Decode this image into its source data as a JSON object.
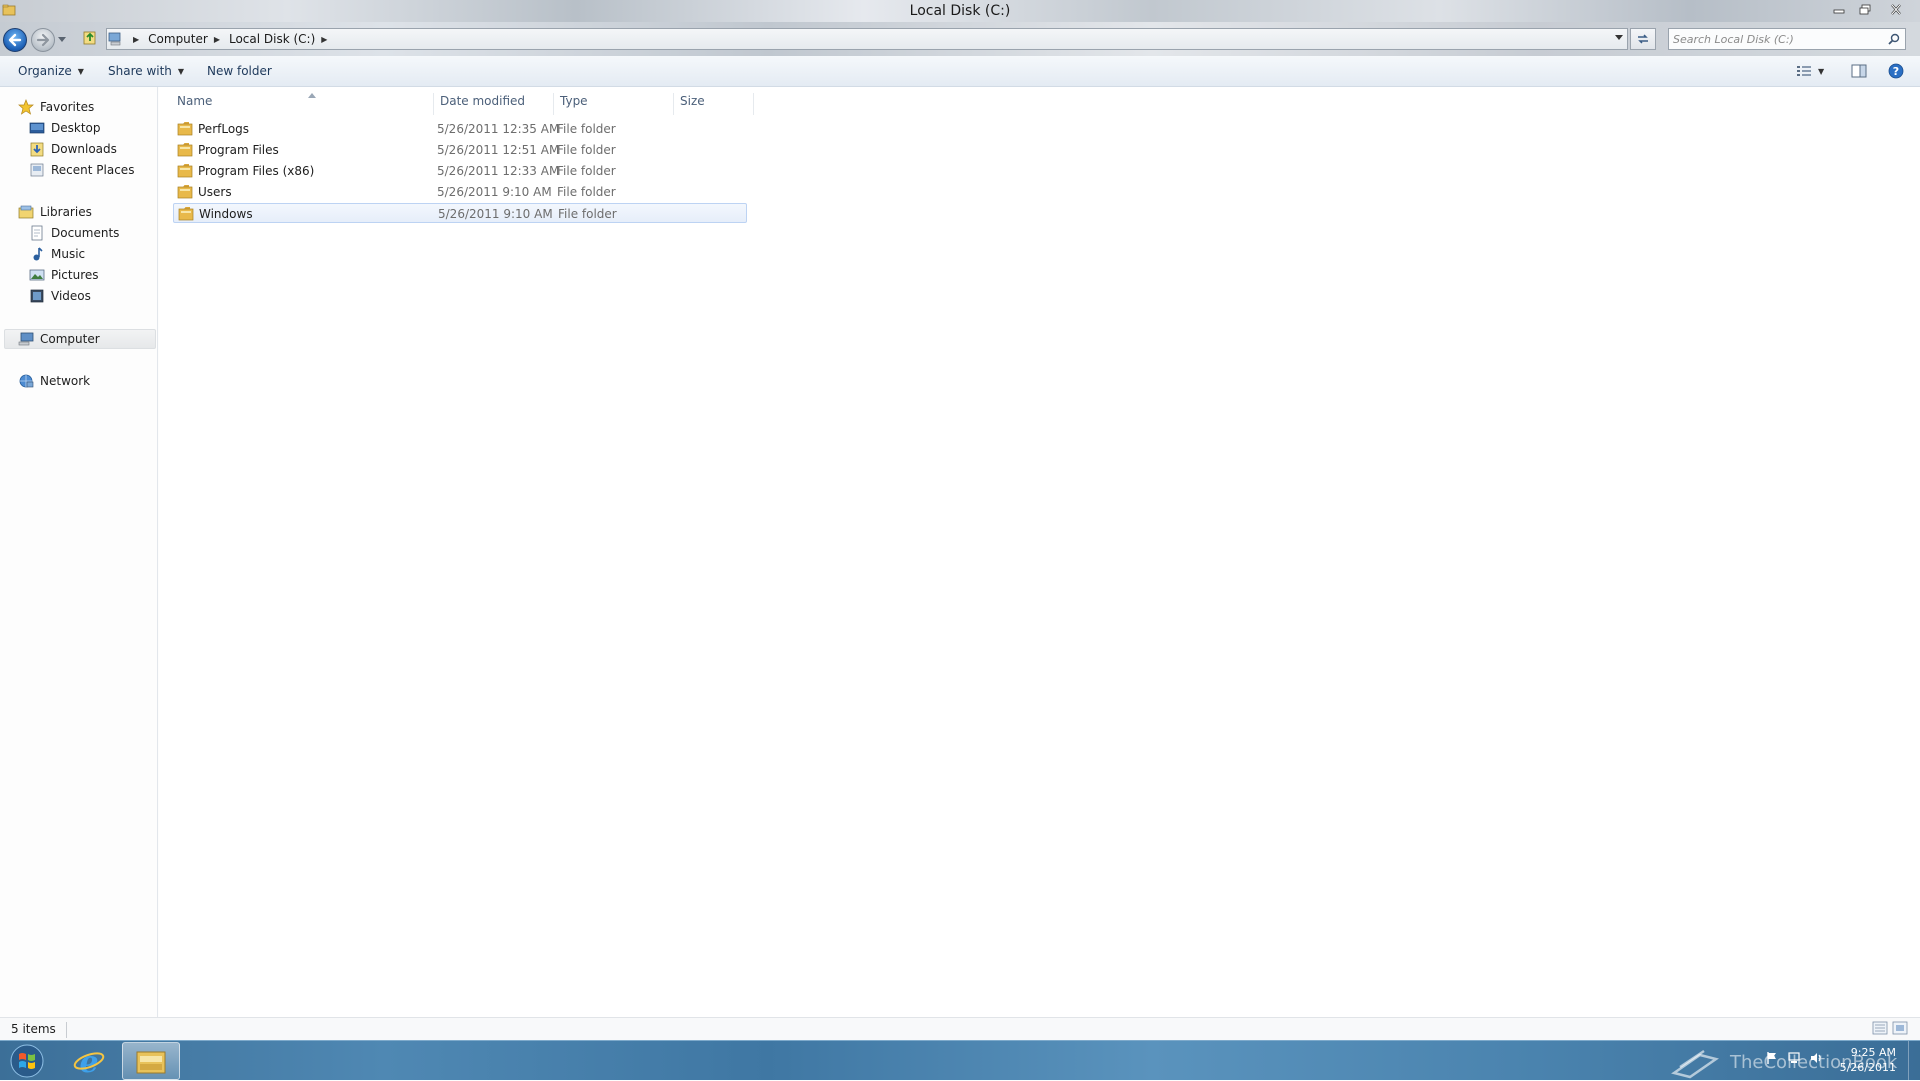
{
  "window": {
    "title": "Local Disk (C:)"
  },
  "address": {
    "breadcrumbs": [
      "Computer",
      "Local Disk (C:)"
    ],
    "search_placeholder": "Search Local Disk (C:)"
  },
  "toolbar": {
    "organize": "Organize",
    "share_with": "Share with",
    "new_folder": "New folder"
  },
  "nav": {
    "favorites": {
      "label": "Favorites",
      "items": [
        "Desktop",
        "Downloads",
        "Recent Places"
      ]
    },
    "libraries": {
      "label": "Libraries",
      "items": [
        "Documents",
        "Music",
        "Pictures",
        "Videos"
      ]
    },
    "computer": "Computer",
    "network": "Network"
  },
  "columns": [
    "Name",
    "Date modified",
    "Type",
    "Size"
  ],
  "files": [
    {
      "name": "PerfLogs",
      "date": "5/26/2011 12:35 AM",
      "type": "File folder"
    },
    {
      "name": "Program Files",
      "date": "5/26/2011 12:51 AM",
      "type": "File folder"
    },
    {
      "name": "Program Files (x86)",
      "date": "5/26/2011 12:33 AM",
      "type": "File folder"
    },
    {
      "name": "Users",
      "date": "5/26/2011 9:10 AM",
      "type": "File folder"
    },
    {
      "name": "Windows",
      "date": "5/26/2011 9:10 AM",
      "type": "File folder"
    }
  ],
  "selected_file": "Windows",
  "status": {
    "item_count": "5 items"
  },
  "taskbar": {
    "watermark": "TheCollectionBook",
    "time": "9:25 AM",
    "date": "5/26/2011"
  },
  "icons": {
    "back": "back-arrow-icon",
    "forward": "forward-arrow-icon",
    "folder": "folder-icon",
    "search": "search-icon",
    "favorites": "star-icon",
    "computer": "computer-icon",
    "network": "network-icon"
  },
  "colors": {
    "accent": "#1c5fb5",
    "selection_border": "#bdd3f3",
    "selection_fill": "#e6eefa",
    "taskbar": "#4a83ae",
    "folder": "#e8b94a"
  }
}
